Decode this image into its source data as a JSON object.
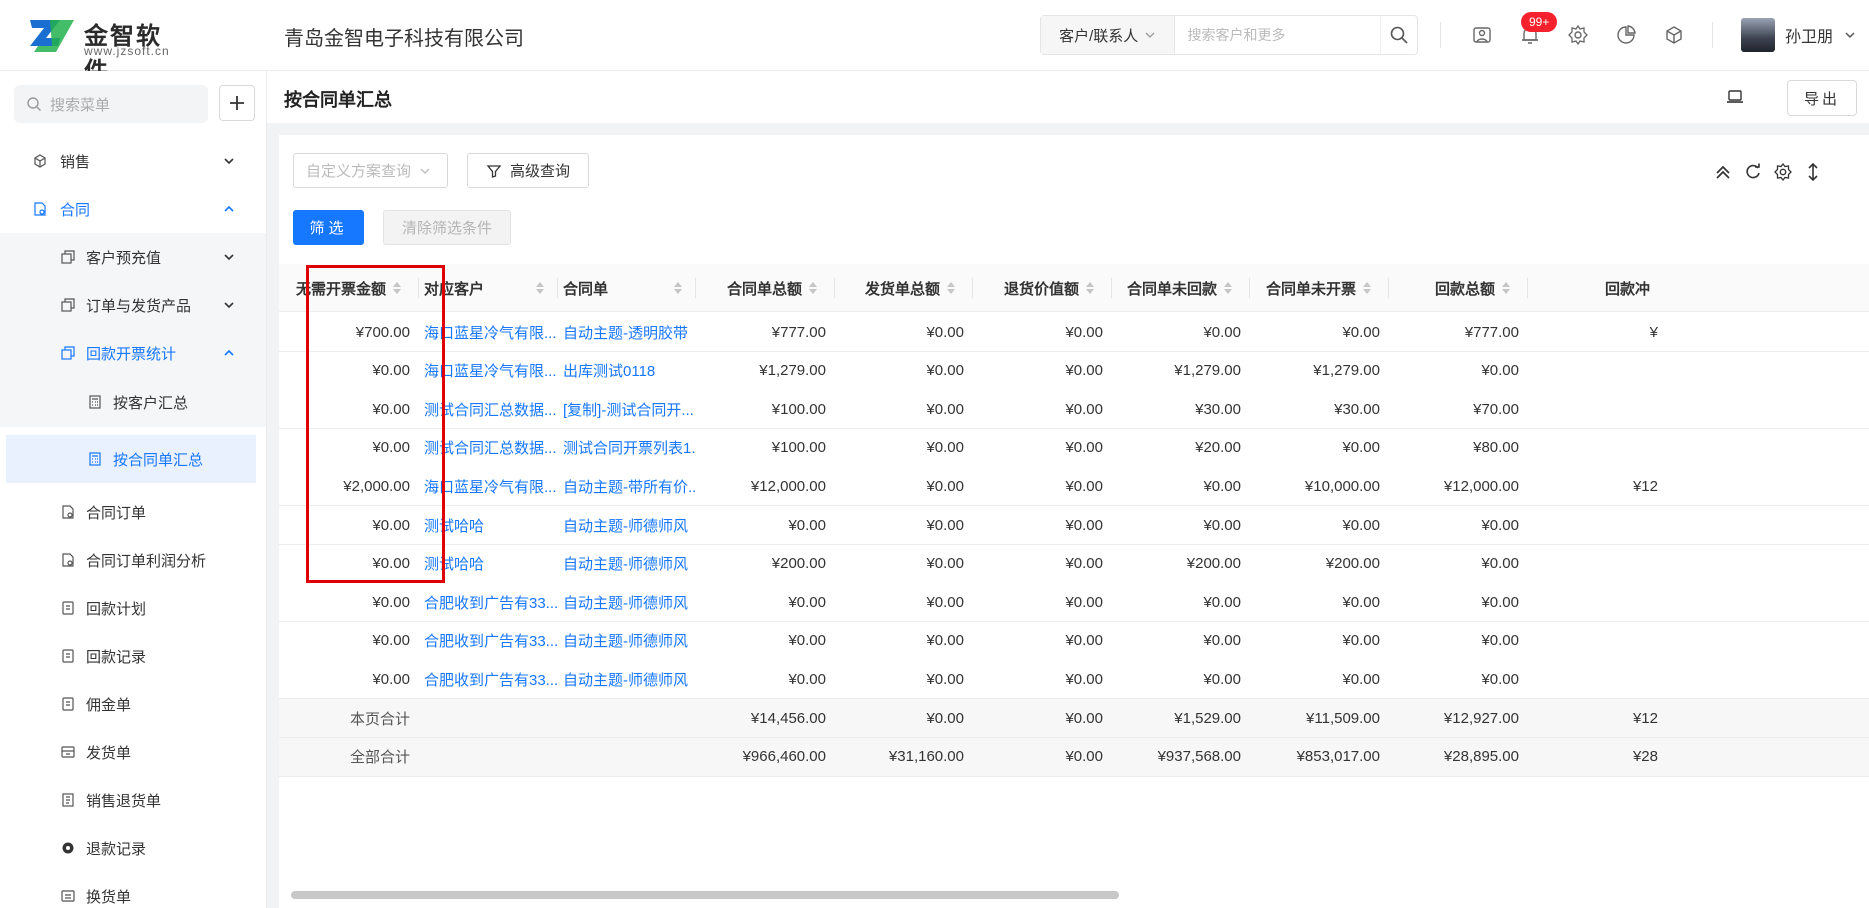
{
  "brand": {
    "name": "金智软件",
    "url": "www.jzsoft.cn",
    "color": "#1a6fd0"
  },
  "company": "青岛金智电子科技有限公司",
  "global_search": {
    "type_label": "客户/联系人",
    "placeholder": "搜索客户和更多"
  },
  "notifications": {
    "badge": "99+"
  },
  "user": {
    "name": "孙卫朋"
  },
  "sidebar": {
    "search_placeholder": "搜索菜单",
    "items": [
      {
        "label": "销售",
        "icon": "cube-icon",
        "expanded": false
      },
      {
        "label": "合同",
        "icon": "contract-icon",
        "expanded": true
      },
      {
        "label": "客户预充值",
        "icon": "copy-icon",
        "expanded": false
      },
      {
        "label": "订单与发货产品",
        "icon": "copy-icon",
        "expanded": false
      },
      {
        "label": "回款开票统计",
        "icon": "copy-icon",
        "expanded": true
      },
      {
        "label": "按客户汇总",
        "icon": "calculator-icon"
      },
      {
        "label": "按合同单汇总",
        "icon": "calculator-icon",
        "selected": true
      },
      {
        "label": "合同订单",
        "icon": "doc-icon"
      },
      {
        "label": "合同订单利润分析",
        "icon": "doc-icon"
      },
      {
        "label": "回款计划",
        "icon": "plan-icon"
      },
      {
        "label": "回款记录",
        "icon": "plan-icon"
      },
      {
        "label": "佣金单",
        "icon": "plan-icon"
      },
      {
        "label": "发货单",
        "icon": "truck-icon"
      },
      {
        "label": "销售退货单",
        "icon": "return-icon"
      },
      {
        "label": "退款记录",
        "icon": "refund-icon"
      },
      {
        "label": "换货单",
        "icon": "exchange-icon"
      }
    ]
  },
  "page": {
    "title": "按合同单汇总",
    "export_label": "导出"
  },
  "toolbar": {
    "scheme_placeholder": "自定义方案查询",
    "advanced_label": "高级查询",
    "filter_label": "筛选",
    "clear_label": "清除筛选条件"
  },
  "table": {
    "columns": [
      "无需开票金额",
      "对应客户",
      "合同单",
      "合同单总额",
      "发货单总额",
      "退货价值额",
      "合同单未回款",
      "合同单未开票",
      "回款总额",
      "回款冲"
    ],
    "rows": [
      [
        "¥700.00",
        "海口蓝星冷气有限...",
        "自动主题-透明胶带",
        "¥777.00",
        "¥0.00",
        "¥0.00",
        "¥0.00",
        "¥0.00",
        "¥777.00",
        "¥"
      ],
      [
        "¥0.00",
        "海口蓝星冷气有限...",
        "出库测试0118",
        "¥1,279.00",
        "¥0.00",
        "¥0.00",
        "¥1,279.00",
        "¥1,279.00",
        "¥0.00",
        ""
      ],
      [
        "¥0.00",
        "测试合同汇总数据...",
        "[复制]-测试合同开...",
        "¥100.00",
        "¥0.00",
        "¥0.00",
        "¥30.00",
        "¥30.00",
        "¥70.00",
        ""
      ],
      [
        "¥0.00",
        "测试合同汇总数据...",
        "测试合同开票列表1...",
        "¥100.00",
        "¥0.00",
        "¥0.00",
        "¥20.00",
        "¥0.00",
        "¥80.00",
        ""
      ],
      [
        "¥2,000.00",
        "海口蓝星冷气有限...",
        "自动主题-带所有价...",
        "¥12,000.00",
        "¥0.00",
        "¥0.00",
        "¥0.00",
        "¥10,000.00",
        "¥12,000.00",
        "¥12"
      ],
      [
        "¥0.00",
        "测试哈哈",
        "自动主题-师德师风",
        "¥0.00",
        "¥0.00",
        "¥0.00",
        "¥0.00",
        "¥0.00",
        "¥0.00",
        ""
      ],
      [
        "¥0.00",
        "测试哈哈",
        "自动主题-师德师风",
        "¥200.00",
        "¥0.00",
        "¥0.00",
        "¥200.00",
        "¥200.00",
        "¥0.00",
        ""
      ],
      [
        "¥0.00",
        "合肥收到广告有33...",
        "自动主题-师德师风",
        "¥0.00",
        "¥0.00",
        "¥0.00",
        "¥0.00",
        "¥0.00",
        "¥0.00",
        ""
      ],
      [
        "¥0.00",
        "合肥收到广告有33...",
        "自动主题-师德师风",
        "¥0.00",
        "¥0.00",
        "¥0.00",
        "¥0.00",
        "¥0.00",
        "¥0.00",
        ""
      ],
      [
        "¥0.00",
        "合肥收到广告有33...",
        "自动主题-师德师风",
        "¥0.00",
        "¥0.00",
        "¥0.00",
        "¥0.00",
        "¥0.00",
        "¥0.00",
        ""
      ]
    ],
    "summary": [
      {
        "label": "本页合计",
        "values": [
          "¥14,456.00",
          "¥0.00",
          "¥0.00",
          "¥1,529.00",
          "¥11,509.00",
          "¥12,927.00",
          "¥12"
        ]
      },
      {
        "label": "全部合计",
        "values": [
          "¥966,460.00",
          "¥31,160.00",
          "¥0.00",
          "¥937,568.00",
          "¥853,017.00",
          "¥28,895.00",
          "¥28"
        ]
      }
    ]
  },
  "highlight": {
    "column": "无需开票金额",
    "color": "#e00000"
  }
}
